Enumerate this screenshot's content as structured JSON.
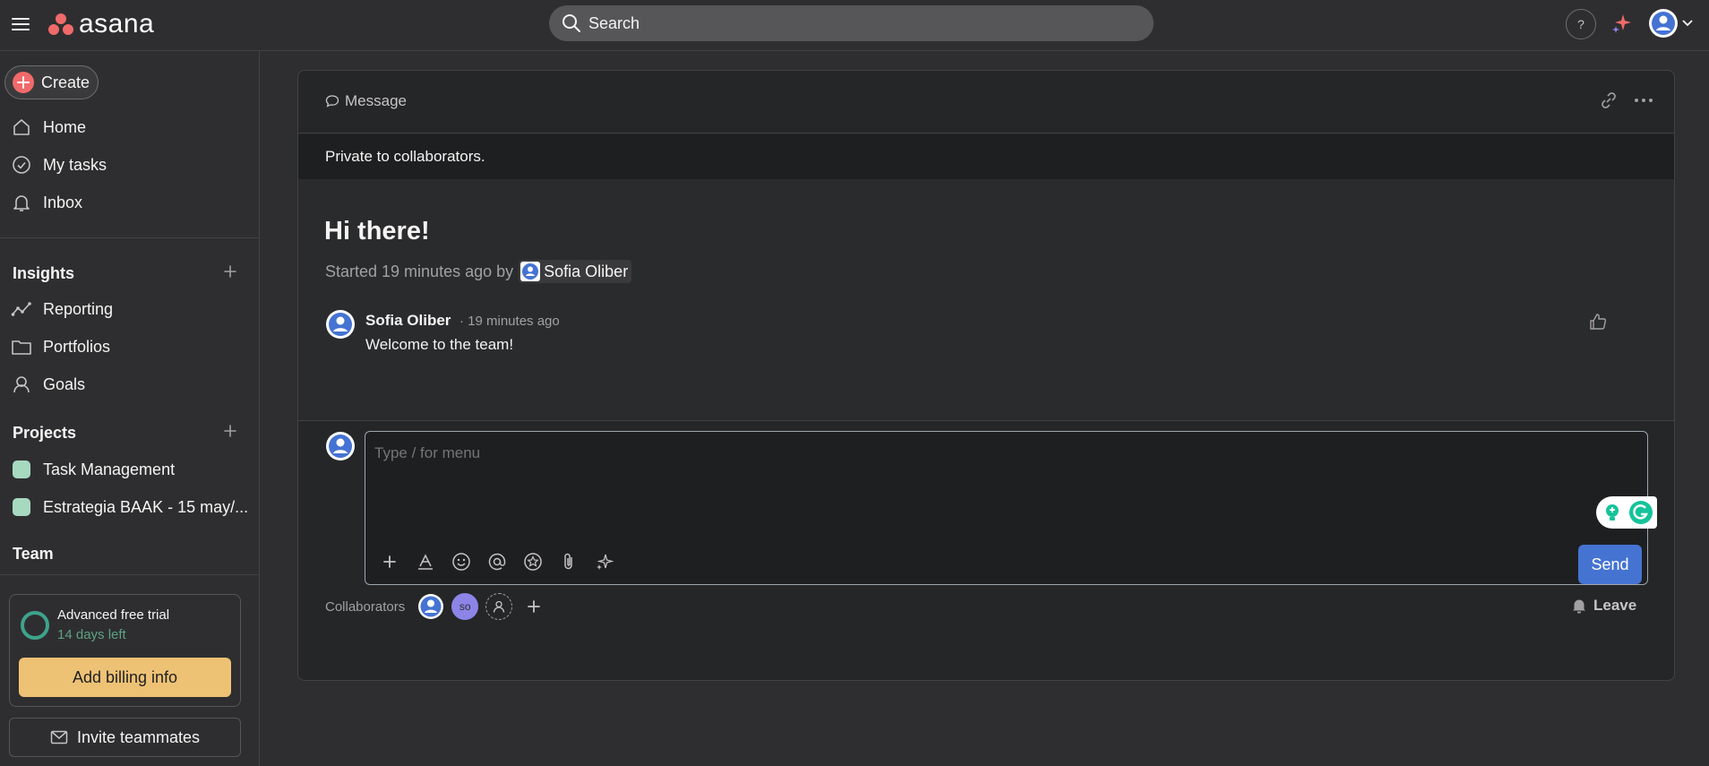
{
  "app": {
    "brand": "asana"
  },
  "topbar": {
    "search_label": "Search",
    "help_label": "?"
  },
  "sidebar": {
    "create_label": "Create",
    "nav": [
      {
        "label": "Home",
        "icon": "home-icon"
      },
      {
        "label": "My tasks",
        "icon": "check-circle-icon"
      },
      {
        "label": "Inbox",
        "icon": "bell-icon"
      }
    ],
    "insights": {
      "title": "Insights",
      "items": [
        {
          "label": "Reporting",
          "icon": "reporting-icon"
        },
        {
          "label": "Portfolios",
          "icon": "folder-icon"
        },
        {
          "label": "Goals",
          "icon": "goals-icon"
        }
      ]
    },
    "projects": {
      "title": "Projects",
      "items": [
        {
          "label": "Task Management",
          "color": "#a7d9c1"
        },
        {
          "label": "Estrategia BAAK - 15 may/...",
          "color": "#a7d9c1"
        }
      ]
    },
    "team_title": "Team",
    "trial": {
      "title": "Advanced free trial",
      "subtitle": "14 days left",
      "billing_label": "Add billing info"
    },
    "invite_label": "Invite teammates"
  },
  "message": {
    "type_label": "Message",
    "privacy_text": "Private to collaborators.",
    "title": "Hi there!",
    "started_prefix": "Started 19 minutes ago by",
    "author": "Sofia Oliber",
    "comment": {
      "author": "Sofia Oliber",
      "time": "· 19 minutes ago",
      "text": "Welcome to the team!"
    },
    "composer": {
      "placeholder": "Type / for menu",
      "send_label": "Send"
    },
    "collaborators": {
      "label": "Collaborators",
      "initials": "so"
    },
    "leave_label": "Leave"
  },
  "colors": {
    "accent": "#4573d2",
    "brand": "#f06a6a",
    "billing": "#eec275",
    "trial_ring": "#3da38c"
  }
}
